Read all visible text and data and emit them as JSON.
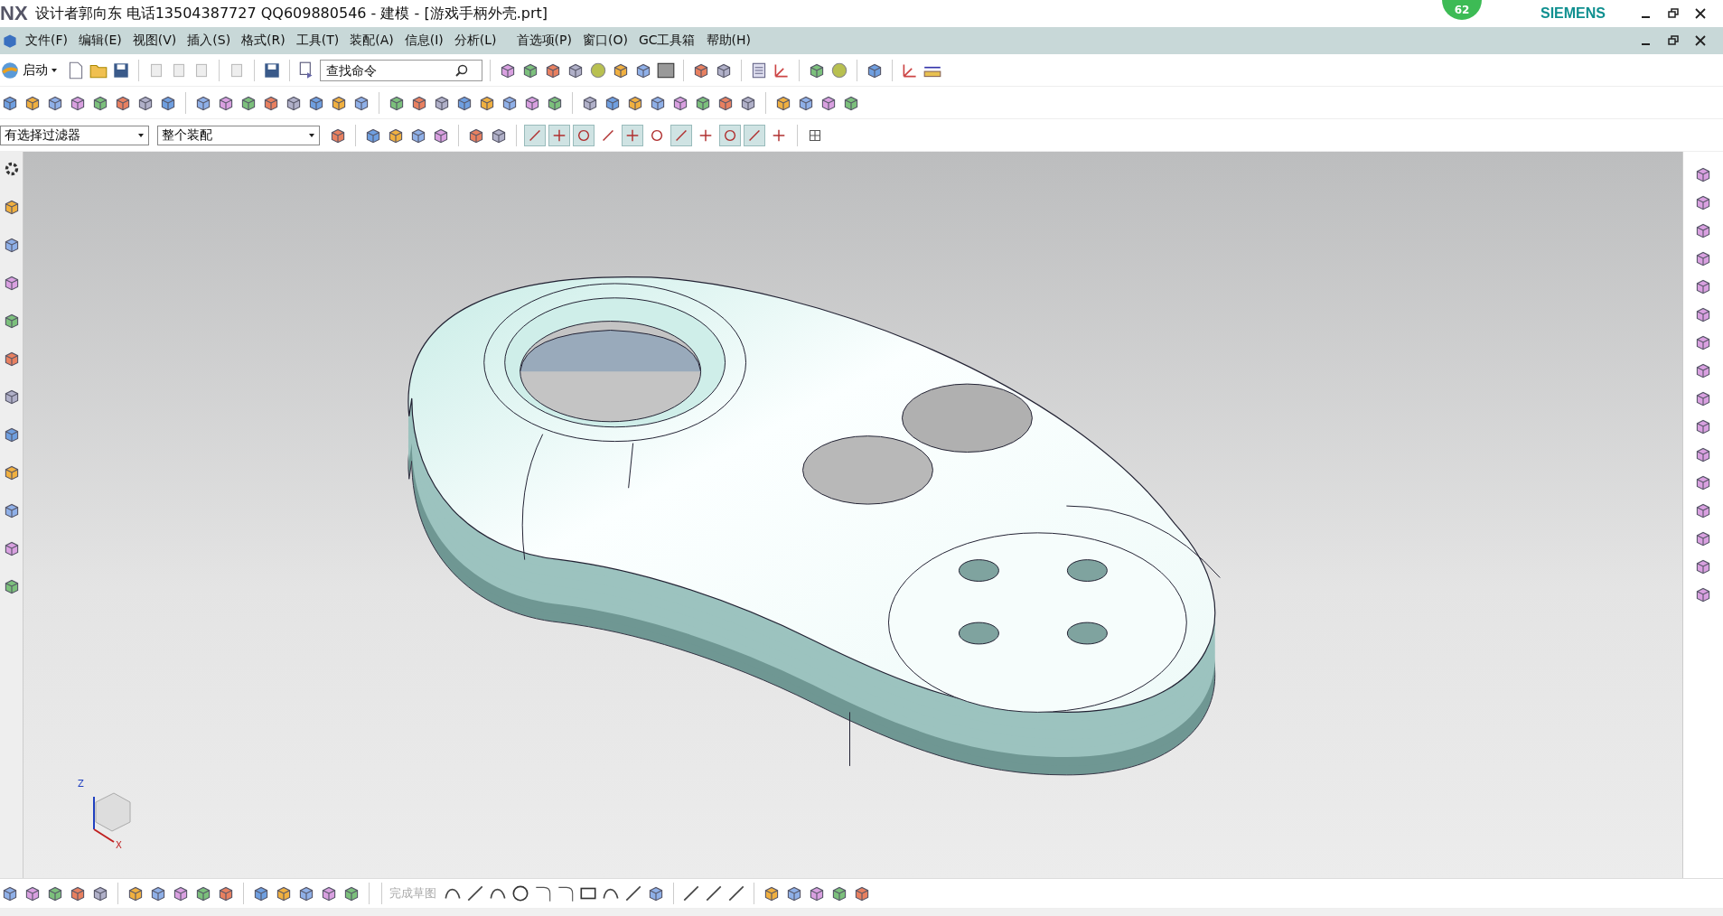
{
  "title_bar": {
    "logo": "NX",
    "title": "设计者郭向东  电话13504387727  QQ609880546 - 建模 - [游戏手柄外壳.prt]",
    "badge": "62",
    "brand": "SIEMENS"
  },
  "menu_bar": {
    "items": [
      {
        "label": "文件(F)"
      },
      {
        "label": "编辑(E)"
      },
      {
        "label": "视图(V)"
      },
      {
        "label": "插入(S)"
      },
      {
        "label": "格式(R)"
      },
      {
        "label": "工具(T)"
      },
      {
        "label": "装配(A)"
      },
      {
        "label": "信息(I)"
      },
      {
        "label": "分析(L)"
      },
      {
        "label": "首选项(P)"
      },
      {
        "label": "窗口(O)"
      },
      {
        "label": "GC工具箱"
      },
      {
        "label": "帮助(H)"
      }
    ]
  },
  "standard_toolbar": {
    "start_label": "启动",
    "search": {
      "placeholder": "查找命令"
    }
  },
  "selection_bar": {
    "filter": "有选择过滤器",
    "scope": "整个装配",
    "snap_points": [
      {
        "selected": true
      },
      {
        "selected": true
      },
      {
        "selected": true
      },
      {
        "selected": false
      },
      {
        "selected": true
      },
      {
        "selected": false
      },
      {
        "selected": true
      },
      {
        "selected": false
      },
      {
        "selected": true
      },
      {
        "selected": true
      },
      {
        "selected": false
      }
    ]
  },
  "bottom_toolbar": {
    "finish_sketch": {
      "label": "完成草图",
      "disabled": true
    }
  },
  "viewport": {
    "triad": {
      "z_label": "Z",
      "x_label": "X"
    }
  }
}
